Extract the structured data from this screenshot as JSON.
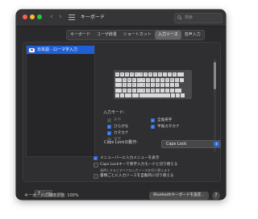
{
  "window": {
    "title": "キーボード",
    "search_placeholder": "検索"
  },
  "tabs": [
    {
      "label": "キーボード",
      "active": false
    },
    {
      "label": "ユーザ辞書",
      "active": false
    },
    {
      "label": "ショートカット",
      "active": false
    },
    {
      "label": "入力ソース",
      "active": true
    },
    {
      "label": "音声入力",
      "active": false
    }
  ],
  "input_sources": [
    {
      "label": "日本語 - ローマ字入力",
      "selected": true
    }
  ],
  "keyboard_keys": {
    "row1": [
      "1",
      "2",
      "3",
      "4",
      "5",
      "6",
      "7",
      "8",
      "9",
      "0",
      "-",
      "^",
      "¥"
    ],
    "row2": [
      "q",
      "w",
      "e",
      "r",
      "t",
      "y",
      "u",
      "i",
      "o",
      "p",
      "@",
      "["
    ],
    "row3": [
      "a",
      "s",
      "d",
      "f",
      "g",
      "h",
      "j",
      "k",
      "l",
      ";",
      ":",
      "]"
    ],
    "row4": [
      "z",
      "x",
      "c",
      "v",
      "b",
      "n",
      "m",
      ",",
      ".",
      "/",
      "_"
    ]
  },
  "input_modes": {
    "label": "入力モード:",
    "options": [
      {
        "label": "英字",
        "checked": true,
        "enabled": false
      },
      {
        "label": "ひらがな",
        "checked": true,
        "enabled": true
      },
      {
        "label": "カタカナ",
        "checked": true,
        "enabled": true
      },
      {
        "label": "漢字",
        "checked": true,
        "enabled": false
      },
      {
        "label": "全角英字",
        "checked": true,
        "enabled": true
      },
      {
        "label": "半角カタカナ",
        "checked": true,
        "enabled": true
      }
    ]
  },
  "caps_lock": {
    "label": "Caps Lockの動作:",
    "value": "Caps Lock"
  },
  "settings": [
    {
      "label": "メニューバーに入力メニューを表示",
      "checked": true
    },
    {
      "label": "Caps Lockキーで英字入力モードと切り替える",
      "checked": false
    },
    {
      "label": "長押しするとすべての入力ソースを切り替えます",
      "checked": false,
      "note": true
    },
    {
      "label": "書類ごとに入力ソースを自動的に切り替える",
      "checked": false
    }
  ],
  "list_controls": {
    "add": "+",
    "remove": "−"
  },
  "footer": {
    "brightness_label": "キーボードの輝度調整: 100%",
    "bluetooth_button": "Bluetoothキーボードを設定...",
    "help": "?"
  },
  "colors": {
    "accent": "#2f6fe0",
    "selection": "#1f5fd6",
    "window_bg": "#2a2a2c"
  },
  "icons": [
    "back-arrow-icon",
    "forward-arrow-icon",
    "grid-icon",
    "search-icon",
    "japan-flag-icon",
    "checkmark-icon",
    "chevron-updown-icon",
    "help-icon"
  ]
}
